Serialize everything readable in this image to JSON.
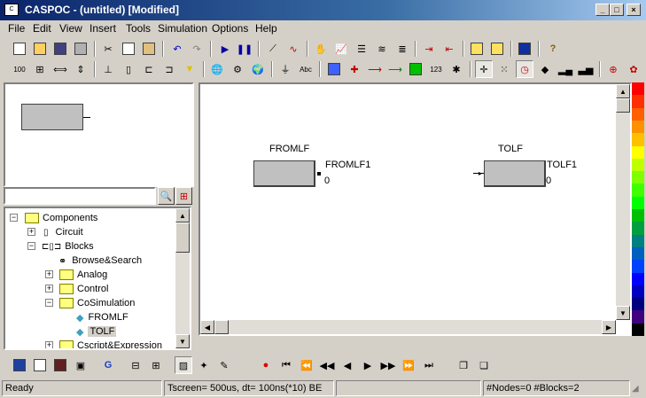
{
  "window": {
    "title": "CASPOC - (untitled) [Modified]"
  },
  "menu": [
    "File",
    "Edit",
    "View",
    "Insert",
    "Tools",
    "Simulation",
    "Options",
    "Help"
  ],
  "preview": {},
  "search": {
    "placeholder": ""
  },
  "tree": {
    "items": [
      {
        "label": "Components",
        "level": 0,
        "expander": "−",
        "icon": "folder"
      },
      {
        "label": "Circuit",
        "level": 1,
        "expander": "+",
        "icon": "circuit"
      },
      {
        "label": "Blocks",
        "level": 1,
        "expander": "−",
        "icon": "blocks"
      },
      {
        "label": "Browse&Search",
        "level": 2,
        "expander": "",
        "icon": "binoculars"
      },
      {
        "label": "Analog",
        "level": 2,
        "expander": "+",
        "icon": "folder"
      },
      {
        "label": "Control",
        "level": 2,
        "expander": "+",
        "icon": "folder"
      },
      {
        "label": "CoSimulation",
        "level": 2,
        "expander": "−",
        "icon": "folder"
      },
      {
        "label": "FROMLF",
        "level": 3,
        "expander": "",
        "icon": "diamond"
      },
      {
        "label": "TOLF",
        "level": 3,
        "expander": "",
        "icon": "diamond",
        "selected": true
      },
      {
        "label": "Cscript&Expression",
        "level": 2,
        "expander": "+",
        "icon": "folder"
      }
    ]
  },
  "canvas": {
    "blocks": [
      {
        "name": "FROMLF",
        "port_label": "FROMLF1",
        "value": "0"
      },
      {
        "name": "TOLF",
        "port_label": "TOLF1",
        "value": "0"
      }
    ]
  },
  "status": {
    "ready": "Ready",
    "sim": "Tscreen= 500us, dt= 100ns(*10) BE",
    "empty": "",
    "counts": "#Nodes=0 #Blocks=2"
  },
  "palette": [
    "#ff0000",
    "#ff3000",
    "#ff6000",
    "#ff9000",
    "#ffc000",
    "#ffff00",
    "#c0ff00",
    "#80ff00",
    "#40ff00",
    "#00ff00",
    "#00c000",
    "#00a040",
    "#008080",
    "#0060c0",
    "#0040ff",
    "#0000ff",
    "#0000c0",
    "#000080",
    "#400080",
    "#000000"
  ],
  "colors": {
    "titlebar": "#0a246a",
    "face": "#d4d0c8",
    "selection": "#d4d0c8"
  }
}
